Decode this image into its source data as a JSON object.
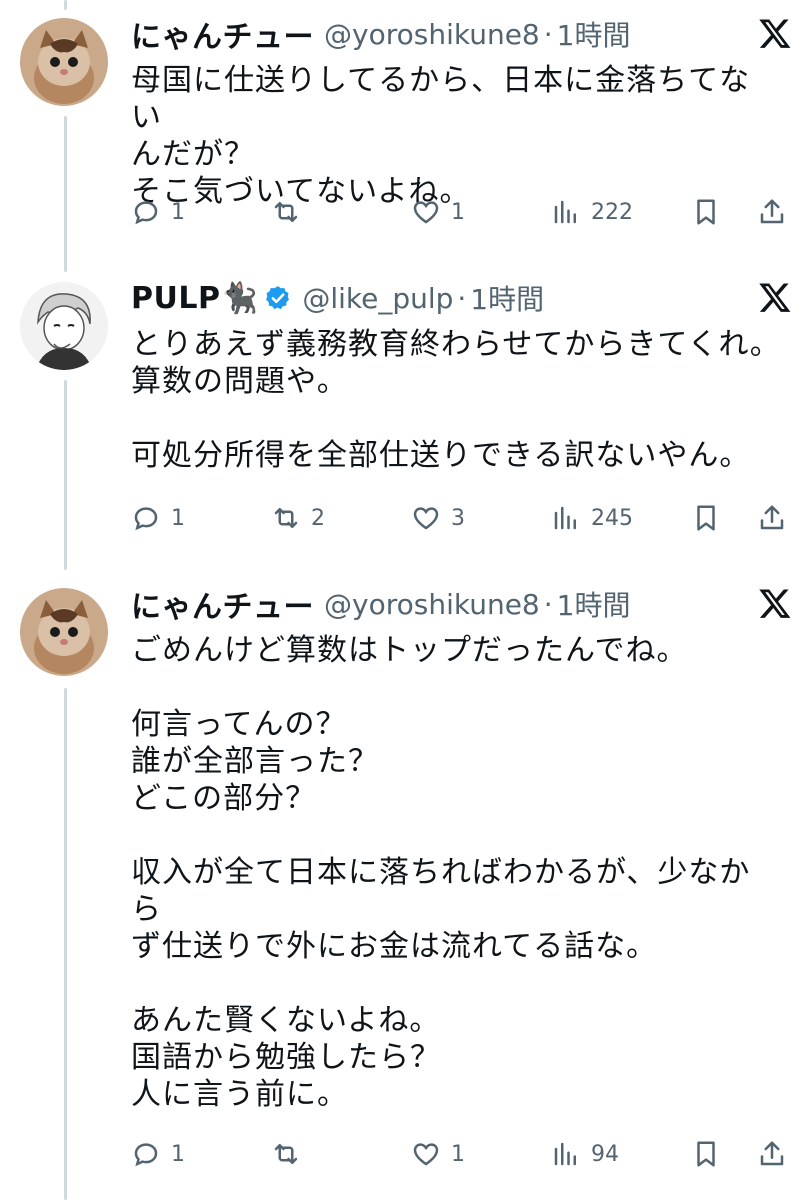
{
  "tweets": [
    {
      "name": "にゃんチュー",
      "handle": "@yoroshikune8",
      "sep": "·",
      "time": "1時間",
      "text": "母国に仕送りしてるから、日本に金落ちてない\nんだが？\nそこ気づいてないよね。",
      "counts": {
        "reply": "1",
        "retweet": "",
        "like": "1",
        "views": "222"
      }
    },
    {
      "name": "PULP🐈‍⬛",
      "handle": "@like_pulp",
      "sep": "·",
      "time": "1時間",
      "text": "とりあえず義務教育終わらせてからきてくれ。\n算数の問題や。\n\n可処分所得を全部仕送りできる訳ないやん。",
      "counts": {
        "reply": "1",
        "retweet": "2",
        "like": "3",
        "views": "245"
      }
    },
    {
      "name": "にゃんチュー",
      "handle": "@yoroshikune8",
      "sep": "·",
      "time": "1時間",
      "text": "ごめんけど算数はトップだったんでね。\n\n何言ってんの？\n誰が全部言った？\nどこの部分？\n\n収入が全て日本に落ちればわかるが、少なから\nず仕送りで外にお金は流れてる話な。\n\nあんた賢くないよね。\n国語から勉強したら？\n人に言う前に。",
      "counts": {
        "reply": "1",
        "retweet": "",
        "like": "1",
        "views": "94"
      }
    }
  ],
  "icons": {
    "reply": "reply-icon",
    "retweet": "retweet-icon",
    "like": "like-icon",
    "views": "views-icon",
    "bookmark": "bookmark-icon",
    "share": "share-icon",
    "x": "x-logo-icon",
    "verified": "verified-badge-icon"
  },
  "colors": {
    "text": "#0f1419",
    "secondary": "#536471",
    "verified": "#1d9bf0",
    "thread_line": "#cfd9de"
  }
}
